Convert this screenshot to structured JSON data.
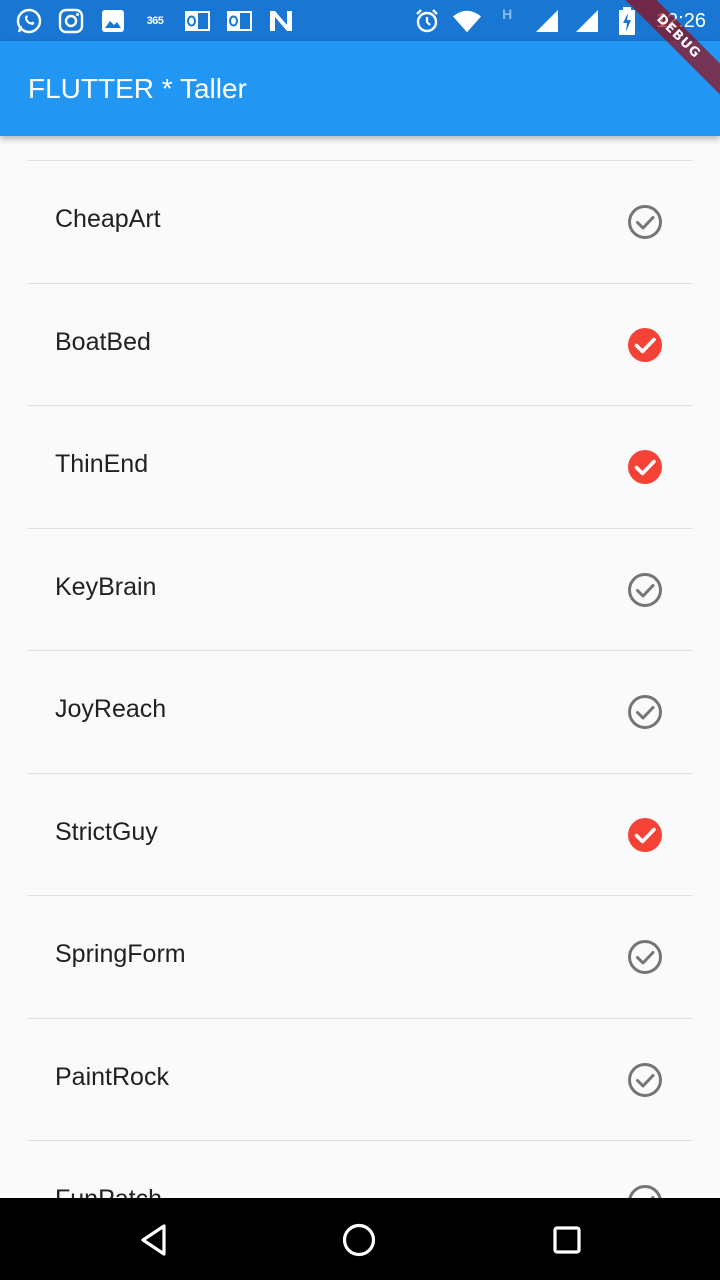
{
  "status_bar": {
    "time": "12:26",
    "notification_icons": [
      "whatsapp-icon",
      "instagram-icon",
      "gallery-icon",
      "office365-icon",
      "outlook-icon",
      "outlook-icon",
      "n-app-icon"
    ],
    "system_icons": [
      "alarm-icon",
      "wifi-icon",
      "h-signal-icon",
      "cell-signal-icon",
      "cell-signal-icon",
      "battery-charging-icon"
    ],
    "label_365": "365",
    "label_h": "H"
  },
  "app_bar": {
    "title": "FLUTTER * Taller",
    "color": "#2196f3"
  },
  "debug_banner": "DEBUG",
  "items": [
    {
      "label": "CheapArt",
      "checked": false
    },
    {
      "label": "BoatBed",
      "checked": true
    },
    {
      "label": "ThinEnd",
      "checked": true
    },
    {
      "label": "KeyBrain",
      "checked": false
    },
    {
      "label": "JoyReach",
      "checked": false
    },
    {
      "label": "StrictGuy",
      "checked": true
    },
    {
      "label": "SpringForm",
      "checked": false
    },
    {
      "label": "PaintRock",
      "checked": false
    },
    {
      "label": "FunPatch",
      "checked": false
    }
  ],
  "colors": {
    "checked": "#f44336",
    "unchecked": "#757575"
  },
  "nav_bar": {
    "buttons": [
      "back-icon",
      "home-icon",
      "recents-icon"
    ]
  }
}
